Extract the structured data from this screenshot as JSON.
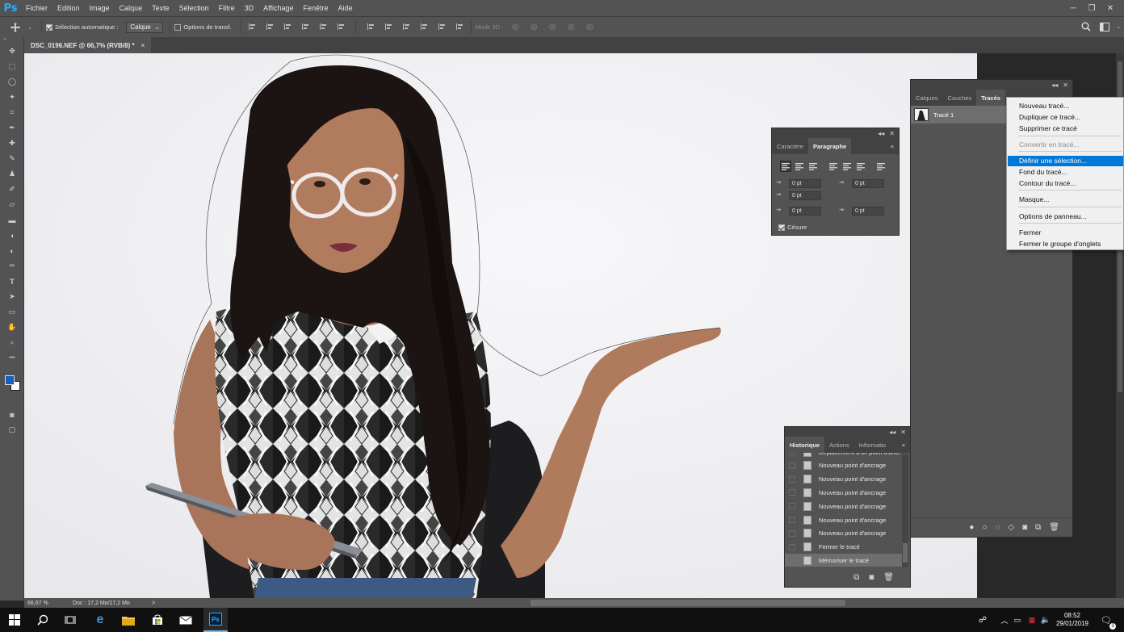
{
  "app": {
    "logo": "Ps",
    "accent_color": "#31a8ff"
  },
  "menu": [
    "Fichier",
    "Edition",
    "Image",
    "Calque",
    "Texte",
    "Sélection",
    "Filtre",
    "3D",
    "Affichage",
    "Fenêtre",
    "Aide"
  ],
  "options": {
    "auto_select_label": "Sélection automatique :",
    "auto_select_value": "Calque",
    "transform_label": "Options de transf.",
    "mode3d_label": "Mode 3D :"
  },
  "document": {
    "tab_title": "DSC_0196.NEF @ 66,7% (RVB/8) *",
    "close": "×"
  },
  "paragraph_panel": {
    "tabs": [
      "Caractère",
      "Paragraphe"
    ],
    "fields": [
      "0 pt",
      "0 pt",
      "0 pt",
      "0 pt",
      "0 pt"
    ],
    "hyphenation_label": "Césure"
  },
  "paths_panel": {
    "tabs": [
      "Calques",
      "Couches",
      "Tracés"
    ],
    "path_name": "Tracé 1"
  },
  "context_menu": {
    "items": [
      "Nouveau tracé...",
      "Dupliquer ce tracé...",
      "Supprimer ce tracé",
      "Convertir en tracé...",
      "Définir une sélection...",
      "Fond du tracé...",
      "Contour du tracé...",
      "Masque...",
      "Options de panneau...",
      "Fermer",
      "Fermer le groupe d'onglets"
    ],
    "disabled_index": 3,
    "selected_index": 4,
    "selected_color": "#0078d7"
  },
  "history_panel": {
    "tabs": [
      "Historique",
      "Actions",
      "Informatio"
    ],
    "items": [
      "Déplacement d'un point d'ancr",
      "Nouveau point d'ancrage",
      "Nouveau point d'ancrage",
      "Nouveau point d'ancrage",
      "Nouveau point d'ancrage",
      "Nouveau point d'ancrage",
      "Nouveau point d'ancrage",
      "Fermer le tracé",
      "Mémoriser le tracé"
    ],
    "active_index": 8
  },
  "status": {
    "zoom": "66,67 %",
    "doc": "Doc : 17,2 Mo/17,2 Mo",
    "arrow": ">"
  },
  "colors": {
    "foreground": "#1560c0",
    "background": "#ffffff"
  },
  "taskbar": {
    "time": "08:52",
    "date": "29/01/2019",
    "notif_count": "3"
  }
}
